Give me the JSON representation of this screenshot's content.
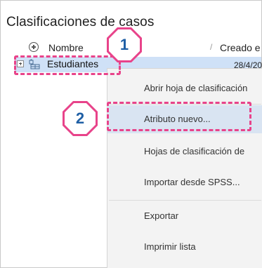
{
  "panel": {
    "title": "Clasificaciones de casos"
  },
  "columns": {
    "name_header": "Nombre",
    "separator": "/",
    "created_header": "Creado e"
  },
  "rows": [
    {
      "label": "Estudiantes",
      "date": "28/4/20"
    }
  ],
  "context_menu": {
    "items": [
      {
        "label": "Abrir hoja de clasificación"
      },
      {
        "label": "Atributo nuevo..."
      },
      {
        "label": "Hojas de clasificación de"
      },
      {
        "label": "Importar desde SPSS..."
      },
      {
        "label": "Exportar"
      },
      {
        "label": "Imprimir lista"
      }
    ]
  },
  "callouts": {
    "step1": "1",
    "step2": "2"
  },
  "colors": {
    "highlight": "#e8438a",
    "badge_text": "#1f5fa5",
    "selected_row": "#cfe1f7",
    "menu_hover": "#d9e4f2"
  }
}
